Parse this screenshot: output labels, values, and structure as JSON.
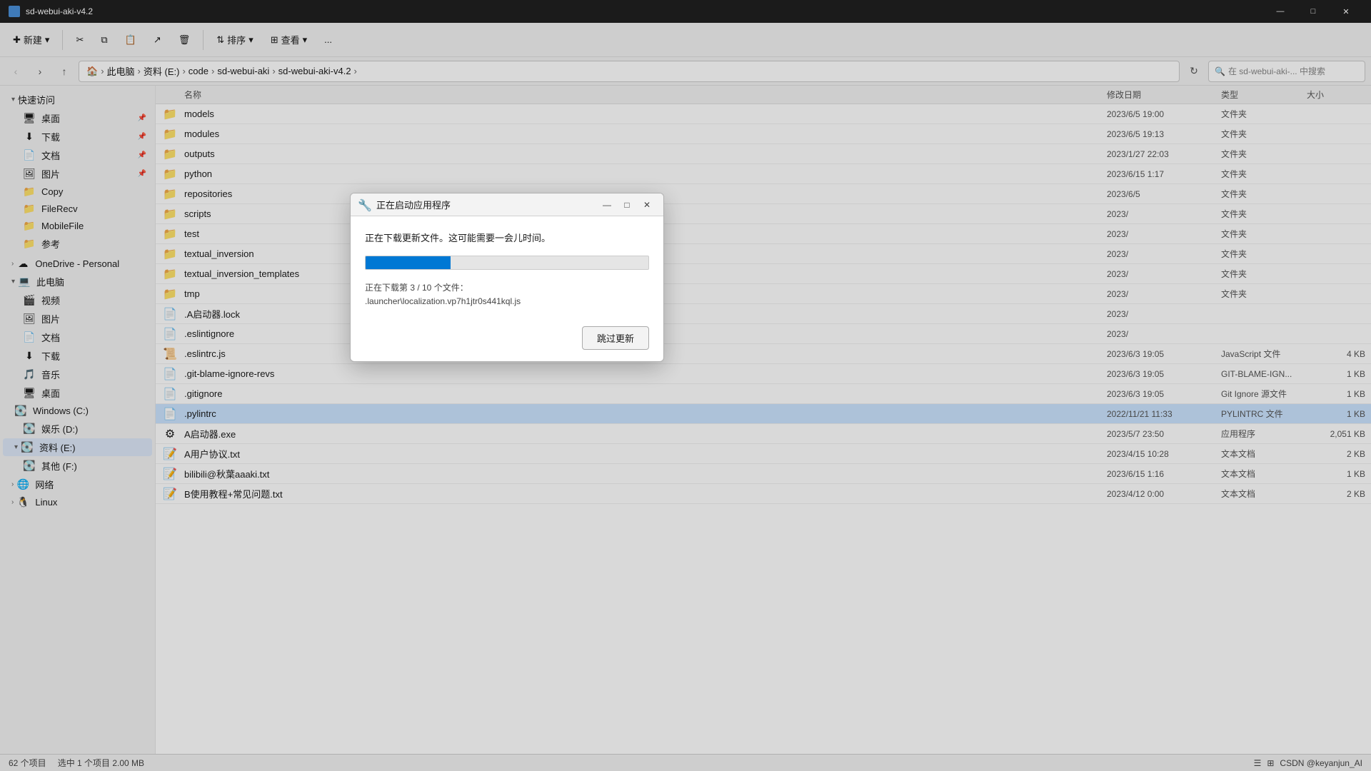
{
  "titlebar": {
    "title": "sd-webui-aki-v4.2",
    "minimize": "—",
    "maximize": "□",
    "close": "✕"
  },
  "toolbar": {
    "new_label": "新建",
    "cut_label": "剪切",
    "copy_label": "复制",
    "paste_label": "粘贴",
    "share_label": "共享",
    "delete_label": "删除",
    "sort_label": "排序",
    "view_label": "查看",
    "more_label": "..."
  },
  "addressbar": {
    "breadcrumb": [
      "此电脑",
      "资料 (E:)",
      "code",
      "sd-webui-aki",
      "sd-webui-aki-v4.2"
    ],
    "search_placeholder": "在 sd-webui-aki-... 中搜索"
  },
  "sidebar": {
    "quick_access": "快速访问",
    "items": [
      {
        "label": "桌面",
        "icon": "🖥",
        "pinned": true
      },
      {
        "label": "下载",
        "icon": "⬇",
        "pinned": true
      },
      {
        "label": "文档",
        "icon": "📄",
        "pinned": true
      },
      {
        "label": "图片",
        "icon": "🖼",
        "pinned": true
      },
      {
        "label": "Copy",
        "icon": "📁"
      },
      {
        "label": "FileRecv",
        "icon": "📁"
      },
      {
        "label": "MobileFile",
        "icon": "📁"
      },
      {
        "label": "参考",
        "icon": "📁"
      }
    ],
    "onedrive": {
      "label": "OneDrive - Personal",
      "icon": "☁"
    },
    "this_pc": {
      "label": "此电脑",
      "children": [
        {
          "label": "视频",
          "icon": "🎬"
        },
        {
          "label": "图片",
          "icon": "🖼"
        },
        {
          "label": "文档",
          "icon": "📄"
        },
        {
          "label": "下载",
          "icon": "⬇"
        },
        {
          "label": "音乐",
          "icon": "🎵"
        },
        {
          "label": "桌面",
          "icon": "🖥"
        },
        {
          "label": "Windows (C:)",
          "icon": "💽"
        },
        {
          "label": "娱乐 (D:)",
          "icon": "💽"
        },
        {
          "label": "资料 (E:)",
          "icon": "💽",
          "selected": true
        },
        {
          "label": "其他 (F:)",
          "icon": "💽"
        }
      ]
    },
    "network": {
      "label": "网络",
      "icon": "🌐"
    },
    "linux": {
      "label": "Linux",
      "icon": "🐧"
    }
  },
  "columns": {
    "name": "名称",
    "date": "修改日期",
    "type": "类型",
    "size": "大小"
  },
  "files": [
    {
      "name": "models",
      "date": "2023/6/5 19:00",
      "type": "文件夹",
      "size": "",
      "icon": "folder"
    },
    {
      "name": "modules",
      "date": "2023/6/5 19:13",
      "type": "文件夹",
      "size": "",
      "icon": "folder"
    },
    {
      "name": "outputs",
      "date": "2023/1/27 22:03",
      "type": "文件夹",
      "size": "",
      "icon": "folder"
    },
    {
      "name": "python",
      "date": "2023/6/15 1:17",
      "type": "文件夹",
      "size": "",
      "icon": "folder"
    },
    {
      "name": "repositories",
      "date": "2023/6/5",
      "type": "文件夹",
      "size": "",
      "icon": "folder"
    },
    {
      "name": "scripts",
      "date": "2023/",
      "type": "文件夹",
      "size": "",
      "icon": "folder"
    },
    {
      "name": "test",
      "date": "2023/",
      "type": "文件夹",
      "size": "",
      "icon": "folder"
    },
    {
      "name": "textual_inversion",
      "date": "2023/",
      "type": "文件夹",
      "size": "",
      "icon": "folder"
    },
    {
      "name": "textual_inversion_templates",
      "date": "2023/",
      "type": "文件夹",
      "size": "",
      "icon": "folder"
    },
    {
      "name": "tmp",
      "date": "2023/",
      "type": "文件夹",
      "size": "",
      "icon": "folder"
    },
    {
      "name": ".A启动器.lock",
      "date": "2023/",
      "type": "",
      "size": "",
      "icon": "file"
    },
    {
      "name": ".eslintignore",
      "date": "2023/",
      "type": "",
      "size": "",
      "icon": "file"
    },
    {
      "name": ".eslintrc.js",
      "date": "2023/6/3 19:05",
      "type": "JavaScript 文件",
      "size": "4 KB",
      "icon": "js"
    },
    {
      "name": ".git-blame-ignore-revs",
      "date": "2023/6/3 19:05",
      "type": "GIT-BLAME-IGN...",
      "size": "1 KB",
      "icon": "file"
    },
    {
      "name": ".gitignore",
      "date": "2023/6/3 19:05",
      "type": "Git Ignore 源文件",
      "size": "1 KB",
      "icon": "file"
    },
    {
      "name": ".pylintrc",
      "date": "2022/11/21 11:33",
      "type": "PYLINTRC 文件",
      "size": "1 KB",
      "icon": "file",
      "selected": true
    },
    {
      "name": "A启动器.exe",
      "date": "2023/5/7 23:50",
      "type": "应用程序",
      "size": "2,051 KB",
      "icon": "exe"
    },
    {
      "name": "A用户协议.txt",
      "date": "2023/4/15 10:28",
      "type": "文本文档",
      "size": "2 KB",
      "icon": "txt"
    },
    {
      "name": "bilibili@秋葉aaaki.txt",
      "date": "2023/6/15 1:16",
      "type": "文本文档",
      "size": "1 KB",
      "icon": "txt"
    },
    {
      "name": "B使用教程+常见问题.txt",
      "date": "2023/4/12 0:00",
      "type": "文本文档",
      "size": "2 KB",
      "icon": "txt"
    }
  ],
  "dialog": {
    "title": "正在启动应用程序",
    "message": "正在下载更新文件。这可能需要一会儿时间。",
    "progress": 30,
    "sub_text": "正在下载第 3 / 10 个文件：",
    "file_path": ".launcher\\localization.vp7h1jtr0s441kql.js",
    "skip_btn": "跳过更新"
  },
  "statusbar": {
    "items_count": "62 个项目",
    "selected_info": "选中 1 个项目  2.00 MB",
    "right_info": "CSDN @keyanjun_AI"
  }
}
